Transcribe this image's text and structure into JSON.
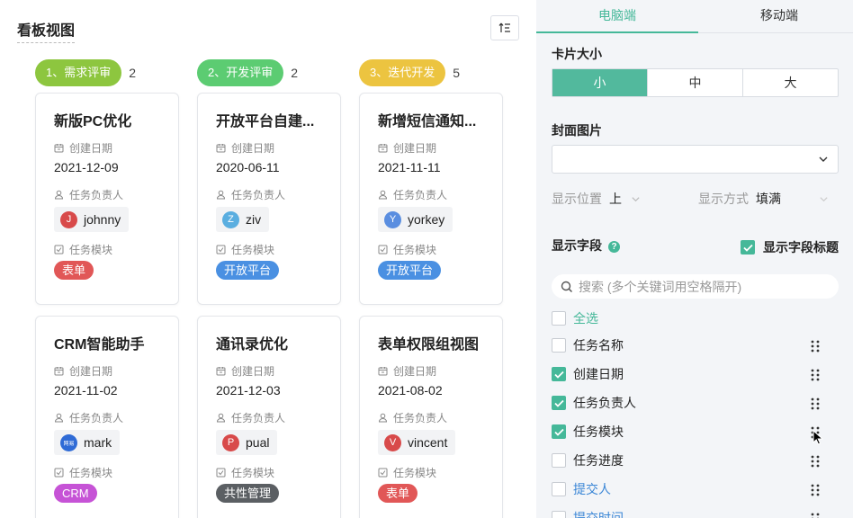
{
  "board": {
    "title": "看板视图",
    "sort_icon": "sort-lines-icon",
    "columns": [
      {
        "pill": "1、需求评审",
        "count": "2",
        "color": "#8dc63f",
        "cards": [
          {
            "title": "新版PC优化",
            "date_label": "创建日期",
            "date": "2021-12-09",
            "owner_label": "任务负责人",
            "owner": "johnny",
            "avatar_letter": "J",
            "avatar_color": "#d84a4a",
            "module_label": "任务模块",
            "module": "表单",
            "module_color": "#e15757"
          },
          {
            "title": "CRM智能助手",
            "date_label": "创建日期",
            "date": "2021-11-02",
            "owner_label": "任务负责人",
            "owner": "mark",
            "avatar_letter": "网易",
            "avatar_color": "#2f6bd6",
            "module_label": "任务模块",
            "module": "CRM",
            "module_color": "#c653d6"
          }
        ]
      },
      {
        "pill": "2、开发评审",
        "count": "2",
        "color": "#5ccc72",
        "cards": [
          {
            "title": "开放平台自建...",
            "date_label": "创建日期",
            "date": "2020-06-11",
            "owner_label": "任务负责人",
            "owner": "ziv",
            "avatar_letter": "Z",
            "avatar_color": "#5aaee0",
            "module_label": "任务模块",
            "module": "开放平台",
            "module_color": "#4a90e2"
          },
          {
            "title": "通讯录优化",
            "date_label": "创建日期",
            "date": "2021-12-03",
            "owner_label": "任务负责人",
            "owner": "pual",
            "avatar_letter": "P",
            "avatar_color": "#d84a4a",
            "module_label": "任务模块",
            "module": "共性管理",
            "module_color": "#5b5f63"
          }
        ]
      },
      {
        "pill": "3、迭代开发",
        "count": "5",
        "color": "#ecc440",
        "cards": [
          {
            "title": "新增短信通知...",
            "date_label": "创建日期",
            "date": "2021-11-11",
            "owner_label": "任务负责人",
            "owner": "yorkey",
            "avatar_letter": "Y",
            "avatar_color": "#5a8ee0",
            "module_label": "任务模块",
            "module": "开放平台",
            "module_color": "#4a90e2"
          },
          {
            "title": "表单权限组视图",
            "date_label": "创建日期",
            "date": "2021-08-02",
            "owner_label": "任务负责人",
            "owner": "vincent",
            "avatar_letter": "V",
            "avatar_color": "#d84a4a",
            "module_label": "任务模块",
            "module": "表单",
            "module_color": "#e15757"
          }
        ]
      }
    ]
  },
  "panel": {
    "tabs": [
      {
        "label": "电脑端",
        "active": true
      },
      {
        "label": "移动端",
        "active": false
      }
    ],
    "card_size": {
      "label": "卡片大小",
      "options": [
        "小",
        "中",
        "大"
      ],
      "selected": "小"
    },
    "cover": {
      "label": "封面图片",
      "value": ""
    },
    "position": {
      "label": "显示位置",
      "value": "上"
    },
    "mode": {
      "label": "显示方式",
      "value": "填满"
    },
    "fields_label": "显示字段",
    "help_icon": "question-icon",
    "show_titles": {
      "label": "显示字段标题",
      "checked": true
    },
    "search_placeholder": "搜索 (多个关键词用空格隔开)",
    "select_all": "全选",
    "fields": [
      {
        "label": "任务名称",
        "checked": false
      },
      {
        "label": "创建日期",
        "checked": true
      },
      {
        "label": "任务负责人",
        "checked": true
      },
      {
        "label": "任务模块",
        "checked": true
      },
      {
        "label": "任务进度",
        "checked": false
      },
      {
        "label": "提交人",
        "checked": false
      },
      {
        "label": "提交时间",
        "checked": false
      }
    ]
  },
  "accent_color": "#45b899"
}
